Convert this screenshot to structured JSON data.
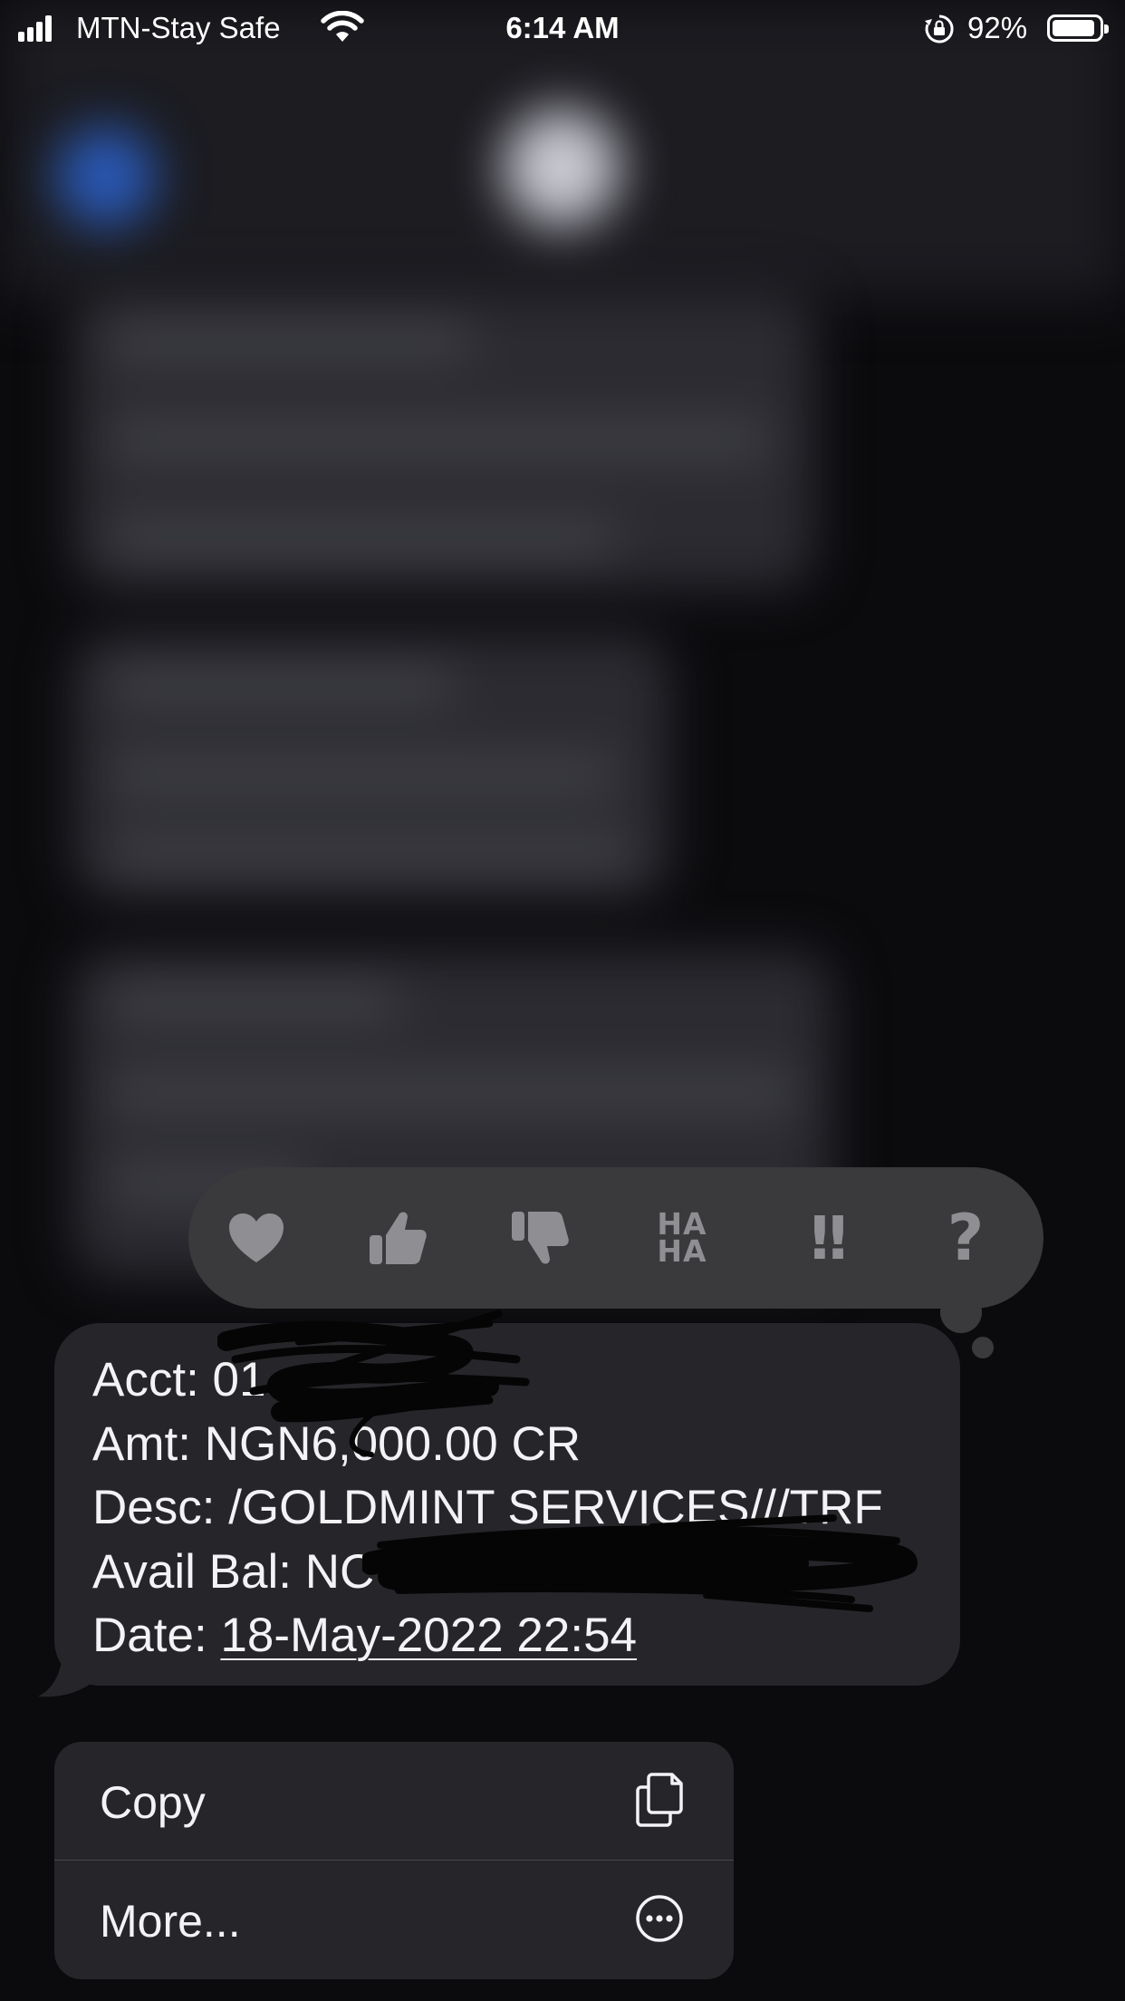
{
  "status_bar": {
    "carrier": "MTN-Stay Safe",
    "time": "6:14 AM",
    "battery_percent": "92%",
    "battery_level": 0.92,
    "icons": [
      "cellular-signal-icon",
      "wifi-icon",
      "orientation-lock-icon",
      "battery-icon"
    ]
  },
  "reactions": [
    "heart",
    "thumbs-up",
    "thumbs-down",
    "HA HA",
    "!!",
    "?"
  ],
  "reaction_labels": {
    "haha_top": "HA",
    "haha_bottom": "HA",
    "emphasis": "!!",
    "question": "?"
  },
  "message": {
    "acct_label": "Acct: ",
    "acct_value": "01",
    "amt_label": "Amt: ",
    "amt_value": "NGN6,000.00 CR",
    "desc_label": "Desc: ",
    "desc_value": "/GOLDMINT SERVICES///TRF",
    "bal_label": "Avail Bal: ",
    "bal_value": "NC",
    "date_label": "Date: ",
    "date_value": "18-May-2022 22:54"
  },
  "menu": {
    "copy_label": "Copy",
    "more_label": "More..."
  },
  "colors": {
    "background": "#0b0b0e",
    "bubble": "#26262a",
    "tapback": "#3a3a3c",
    "reaction_icon": "#8e8e93",
    "text": "#f3f3f6"
  }
}
